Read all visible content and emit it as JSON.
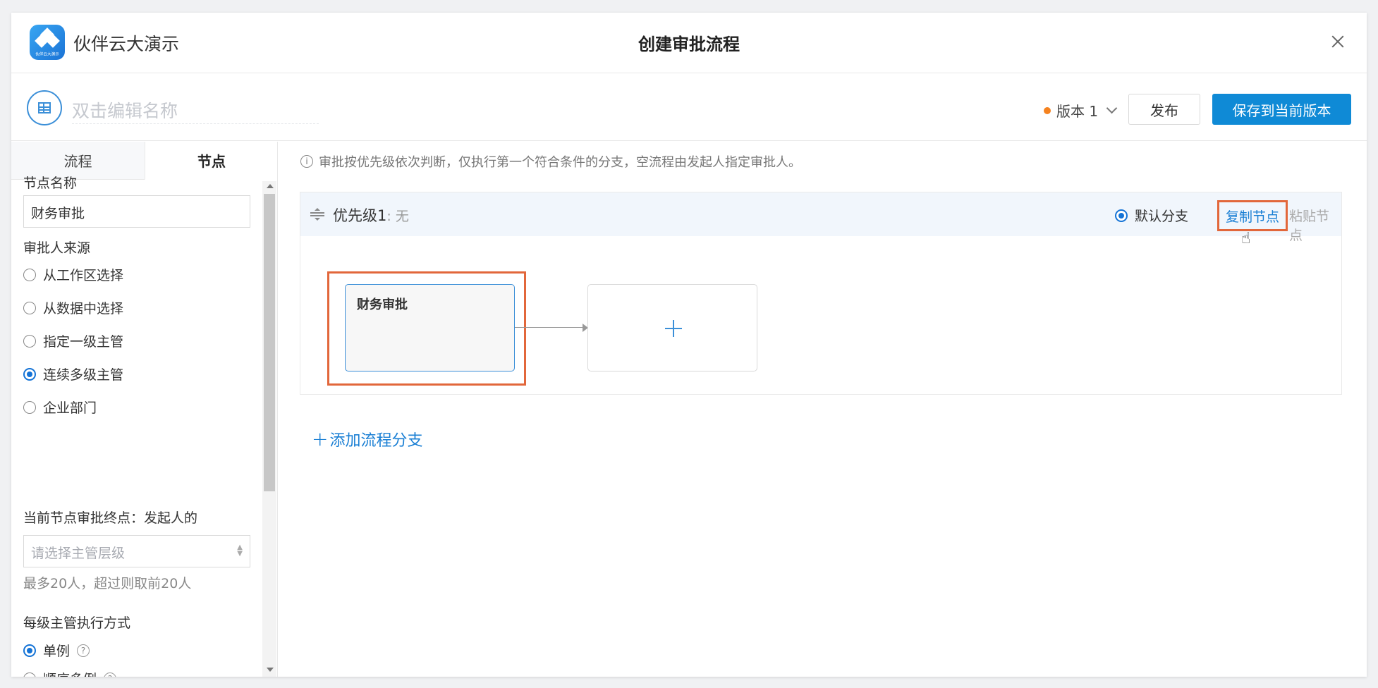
{
  "header": {
    "app_name": "伙伴云大演示",
    "logo_text": "伙伴云大演示",
    "modal_title": "创建审批流程"
  },
  "toolbar": {
    "name_placeholder": "双击编辑名称",
    "version_label": "版本 1",
    "publish_label": "发布",
    "save_label": "保存到当前版本"
  },
  "sidebar": {
    "tabs": [
      {
        "label": "流程",
        "active": false
      },
      {
        "label": "节点",
        "active": true
      }
    ],
    "node_name_label": "节点名称",
    "node_name_value": "财务审批",
    "approver_source_label": "审批人来源",
    "approver_options": [
      {
        "label": "从工作区选择",
        "checked": false
      },
      {
        "label": "从数据中选择",
        "checked": false
      },
      {
        "label": "指定一级主管",
        "checked": false
      },
      {
        "label": "连续多级主管",
        "checked": true
      },
      {
        "label": "企业部门",
        "checked": false
      }
    ],
    "endpoint_label": "当前节点审批终点：发起人的",
    "level_placeholder": "请选择主管层级",
    "max_hint": "最多20人，超过则取前20人",
    "mode_label": "每级主管执行方式",
    "mode_options": [
      {
        "label": "单例",
        "checked": true
      },
      {
        "label": "顺序多例",
        "checked": false
      }
    ]
  },
  "main": {
    "notice": "审批按优先级依次判断，仅执行第一个符合条件的分支，空流程由发起人指定审批人。",
    "branch": {
      "priority_label": "优先级1",
      "condition": ": 无",
      "default_branch_label": "默认分支",
      "copy_node_label": "复制节点",
      "paste_node_label": "粘贴节点"
    },
    "node_title": "财务审批",
    "add_branch_label": "添加流程分支"
  },
  "colors": {
    "primary": "#0f8ad6",
    "link": "#1a7fd4",
    "highlight": "#e2673b",
    "version_dot": "#f5821f"
  }
}
